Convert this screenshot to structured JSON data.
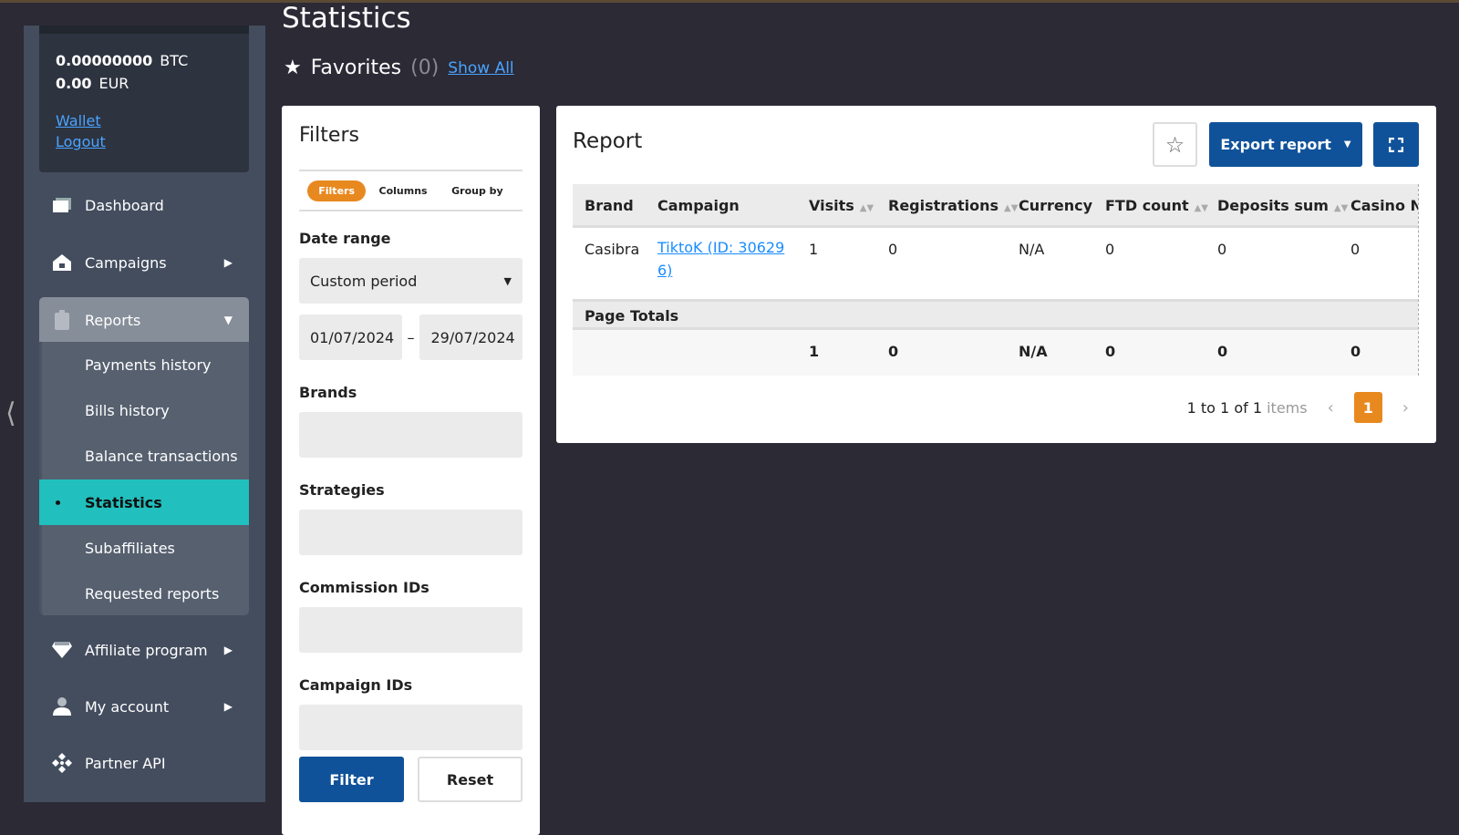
{
  "page_title": "Statistics",
  "favorites": {
    "label": "Favorites",
    "count": "(0)",
    "show_all": "Show All"
  },
  "wallet": {
    "btc_amount": "0.00000000",
    "btc_currency": "BTC",
    "eur_amount": "0.00",
    "eur_currency": "EUR",
    "wallet_link": "Wallet",
    "logout_link": "Logout"
  },
  "sidebar": {
    "items": [
      {
        "label": "Dashboard",
        "icon": "dashboard-icon"
      },
      {
        "label": "Campaigns",
        "icon": "home-icon"
      },
      {
        "label": "Reports",
        "icon": "clipboard-icon"
      },
      {
        "label": "Affiliate program",
        "icon": "diamond-icon"
      },
      {
        "label": "My account",
        "icon": "user-icon"
      },
      {
        "label": "Partner API",
        "icon": "api-icon"
      }
    ],
    "reports_sub": [
      "Payments history",
      "Bills history",
      "Balance transactions",
      "Statistics",
      "Subaffiliates",
      "Requested reports"
    ],
    "active": "Statistics"
  },
  "filters": {
    "title": "Filters",
    "tabs": [
      "Filters",
      "Columns",
      "Group by"
    ],
    "active_tab": "Filters",
    "date_range_label": "Date range",
    "date_range_value": "Custom period",
    "date_from": "01/07/2024",
    "date_sep": "–",
    "date_to": "29/07/2024",
    "brands_label": "Brands",
    "strategies_label": "Strategies",
    "commission_label": "Commission IDs",
    "campaign_label": "Campaign IDs",
    "filter_btn": "Filter",
    "reset_btn": "Reset"
  },
  "report": {
    "title": "Report",
    "export_btn": "Export report",
    "columns": [
      "Brand",
      "Campaign",
      "Visits",
      "Registrations",
      "Currency",
      "FTD count",
      "Deposits sum",
      "Casino NGR"
    ],
    "rows": [
      {
        "brand": "Casibra",
        "campaign": "TiktoK (ID: 306296)",
        "campaign_l1": "TiktoK (ID: 30629",
        "campaign_l2": "6)",
        "visits": "1",
        "registrations": "0",
        "currency": "N/A",
        "ftd": "0",
        "deposits": "0",
        "casino": "0"
      }
    ],
    "page_totals_label": "Page Totals",
    "totals": {
      "visits": "1",
      "registrations": "0",
      "currency": "N/A",
      "ftd": "0",
      "deposits": "0",
      "casino": "0"
    },
    "pagination": {
      "range": "1 to 1 of 1",
      "items": "items",
      "current": "1"
    }
  },
  "colors": {
    "accent_orange": "#e8891f",
    "primary_blue": "#10529a",
    "active_teal": "#21bfbd",
    "link": "#1a8cff"
  }
}
